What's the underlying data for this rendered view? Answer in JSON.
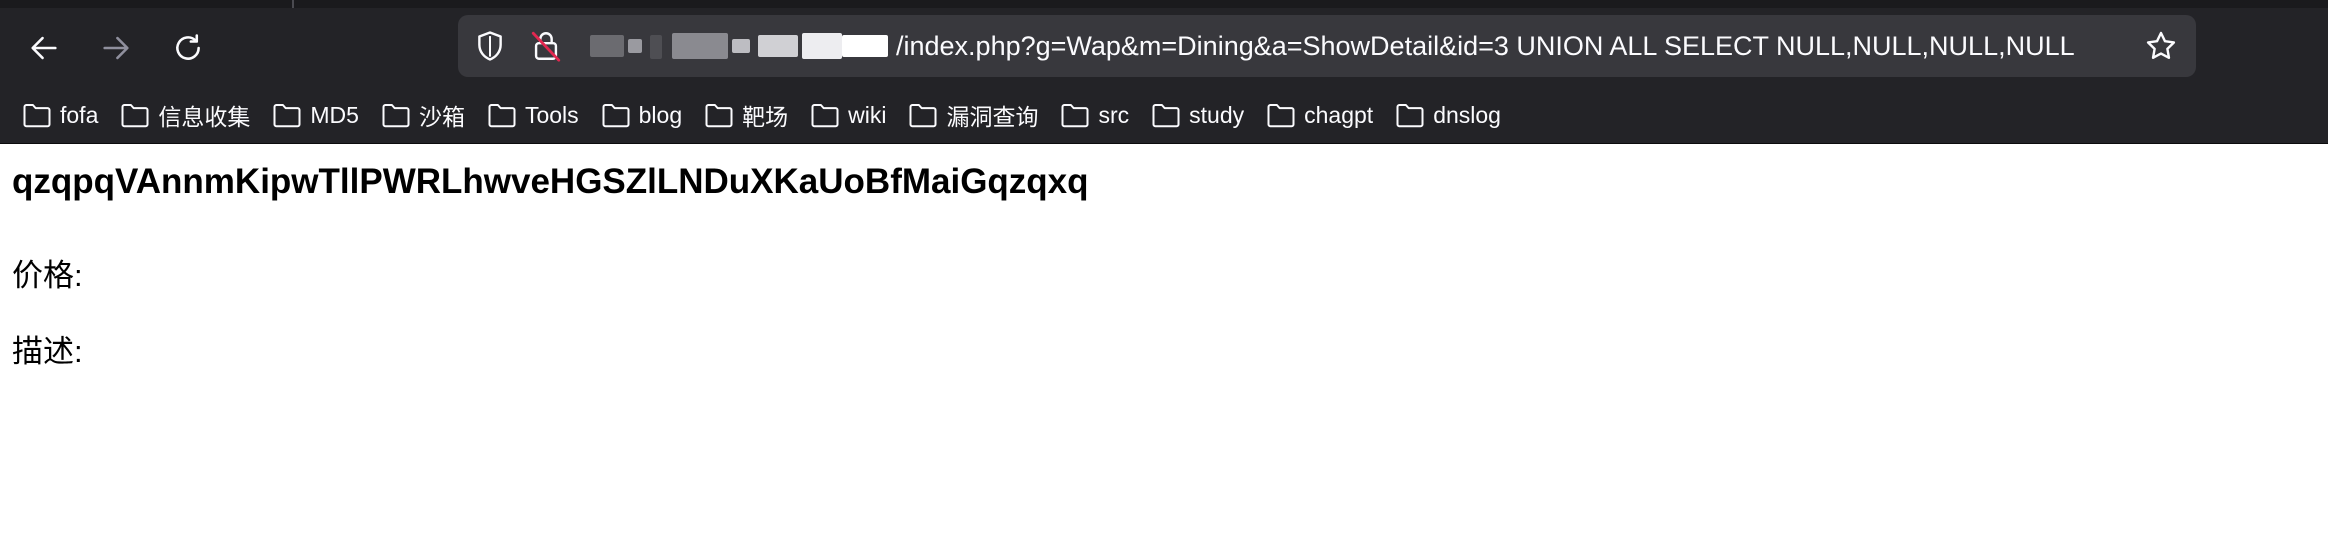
{
  "browser": {
    "url_visible": "/index.php?g=Wap&m=Dining&a=ShowDetail&id=3 UNION ALL SELECT NULL,NULL,NULL,NULL",
    "icons": {
      "back": "arrow-left-icon",
      "forward": "arrow-right-icon",
      "reload": "reload-icon",
      "tracking_protection": "shield-icon",
      "insecure": "lock-slash-icon",
      "bookmark_star": "star-icon"
    },
    "colors": {
      "toolbar": "#232327",
      "urlbar": "#38383d",
      "text": "#fbfbfe"
    }
  },
  "bookmarks": [
    {
      "label": "fofa"
    },
    {
      "label": "信息收集"
    },
    {
      "label": "MD5"
    },
    {
      "label": "沙箱"
    },
    {
      "label": "Tools"
    },
    {
      "label": "blog"
    },
    {
      "label": "靶场"
    },
    {
      "label": "wiki"
    },
    {
      "label": "漏洞查询"
    },
    {
      "label": "src"
    },
    {
      "label": "study"
    },
    {
      "label": "chagpt"
    },
    {
      "label": "dnslog"
    }
  ],
  "page": {
    "title": "qzqpqVAnnmKipwTllPWRLhwveHGSZlLNDuXKaUoBfMaiGqzqxq",
    "price_label": "价格:",
    "description_label": "描述:"
  }
}
